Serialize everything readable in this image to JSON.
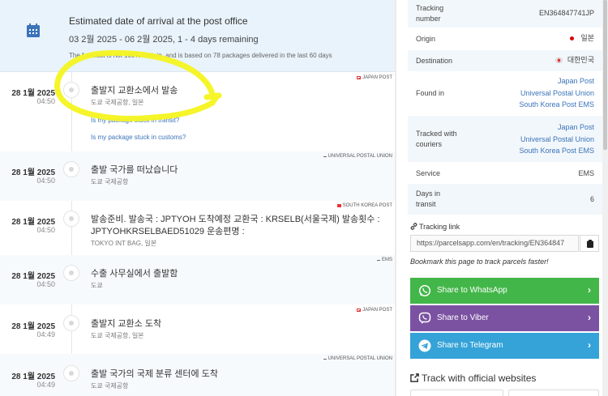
{
  "eta": {
    "icon": "calendar-icon",
    "title": "Estimated date of arrival at the post office",
    "dates": "03 2월 2025 - 06 2월 2025, 1 - 4 days remaining",
    "note": "The forecast is not 100% certain, and is based on 78 packages delivered in the last 60 days"
  },
  "events": [
    {
      "date": "28 1월 2025",
      "time": "04:50",
      "status": "출발지 교환소에서 발송",
      "location": "도쿄 국제공항, 일본",
      "courier": "JAPAN POST",
      "links": [
        "Is my package stuck in transit?",
        "Is my package stuck in customs?"
      ]
    },
    {
      "date": "28 1월 2025",
      "time": "04:50",
      "status": "출발 국가를 떠났습니다",
      "location": "도쿄 국제공항",
      "courier": "UNIVERSAL POSTAL UNION"
    },
    {
      "date": "28 1월 2025",
      "time": "04:50",
      "status_line1": "발송준비. 발송국 : JPTYOH 도착예정 교환국 : KRSELB(서울국제) 발송횟수 :",
      "status_line2": "JPTYOHKRSELBAED51029 운송편명 :",
      "location": "TOKYO INT BAG, 일본",
      "courier": "SOUTH KOREA POST"
    },
    {
      "date": "28 1월 2025",
      "time": "04:50",
      "status": "수출 사무실에서 출발함",
      "location": "도쿄",
      "courier": "EMS"
    },
    {
      "date": "28 1월 2025",
      "time": "04:49",
      "status": "출발지 교환소 도착",
      "location": "도쿄 국제공항, 일본",
      "courier": "JAPAN POST"
    },
    {
      "date": "28 1월 2025",
      "time": "04:49",
      "status": "출발 국가의 국제 분류 센터에 도착",
      "location": "도쿄 국제공항",
      "courier": "UNIVERSAL POSTAL UNION"
    }
  ],
  "info": {
    "tracking_number_label": "Tracking number",
    "tracking_number": "EN364847741JP",
    "origin_label": "Origin",
    "origin": "일본",
    "destination_label": "Destination",
    "destination": "대한민국",
    "found_in_label": "Found in",
    "found_in": [
      "Japan Post",
      "Universal Postal Union",
      "South Korea Post  EMS"
    ],
    "tracked_with_label": "Tracked with couriers",
    "tracked_with": [
      "Japan Post",
      "Universal Postal Union",
      "South Korea Post  EMS"
    ],
    "service_label": "Service",
    "service": "EMS",
    "days_label": "Days in transit",
    "days": "6"
  },
  "tracking_link": {
    "label": "Tracking link",
    "url": "https://parcelsapp.com/en/tracking/EN364847",
    "bookmark": "Bookmark this page to track parcels faster!"
  },
  "share": [
    {
      "label": "Share to WhatsApp",
      "color": "#43b649",
      "icon": "whatsapp-icon"
    },
    {
      "label": "Share to Viber",
      "color": "#7b52a2",
      "icon": "viber-icon"
    },
    {
      "label": "Share to Telegram",
      "color": "#35a3d8",
      "icon": "telegram-icon"
    }
  ],
  "official": {
    "title": "Track with official websites"
  },
  "colors": {
    "accent": "#3b73b9",
    "eta_bg": "#e9f3fb",
    "highlight": "#f4f41f"
  }
}
